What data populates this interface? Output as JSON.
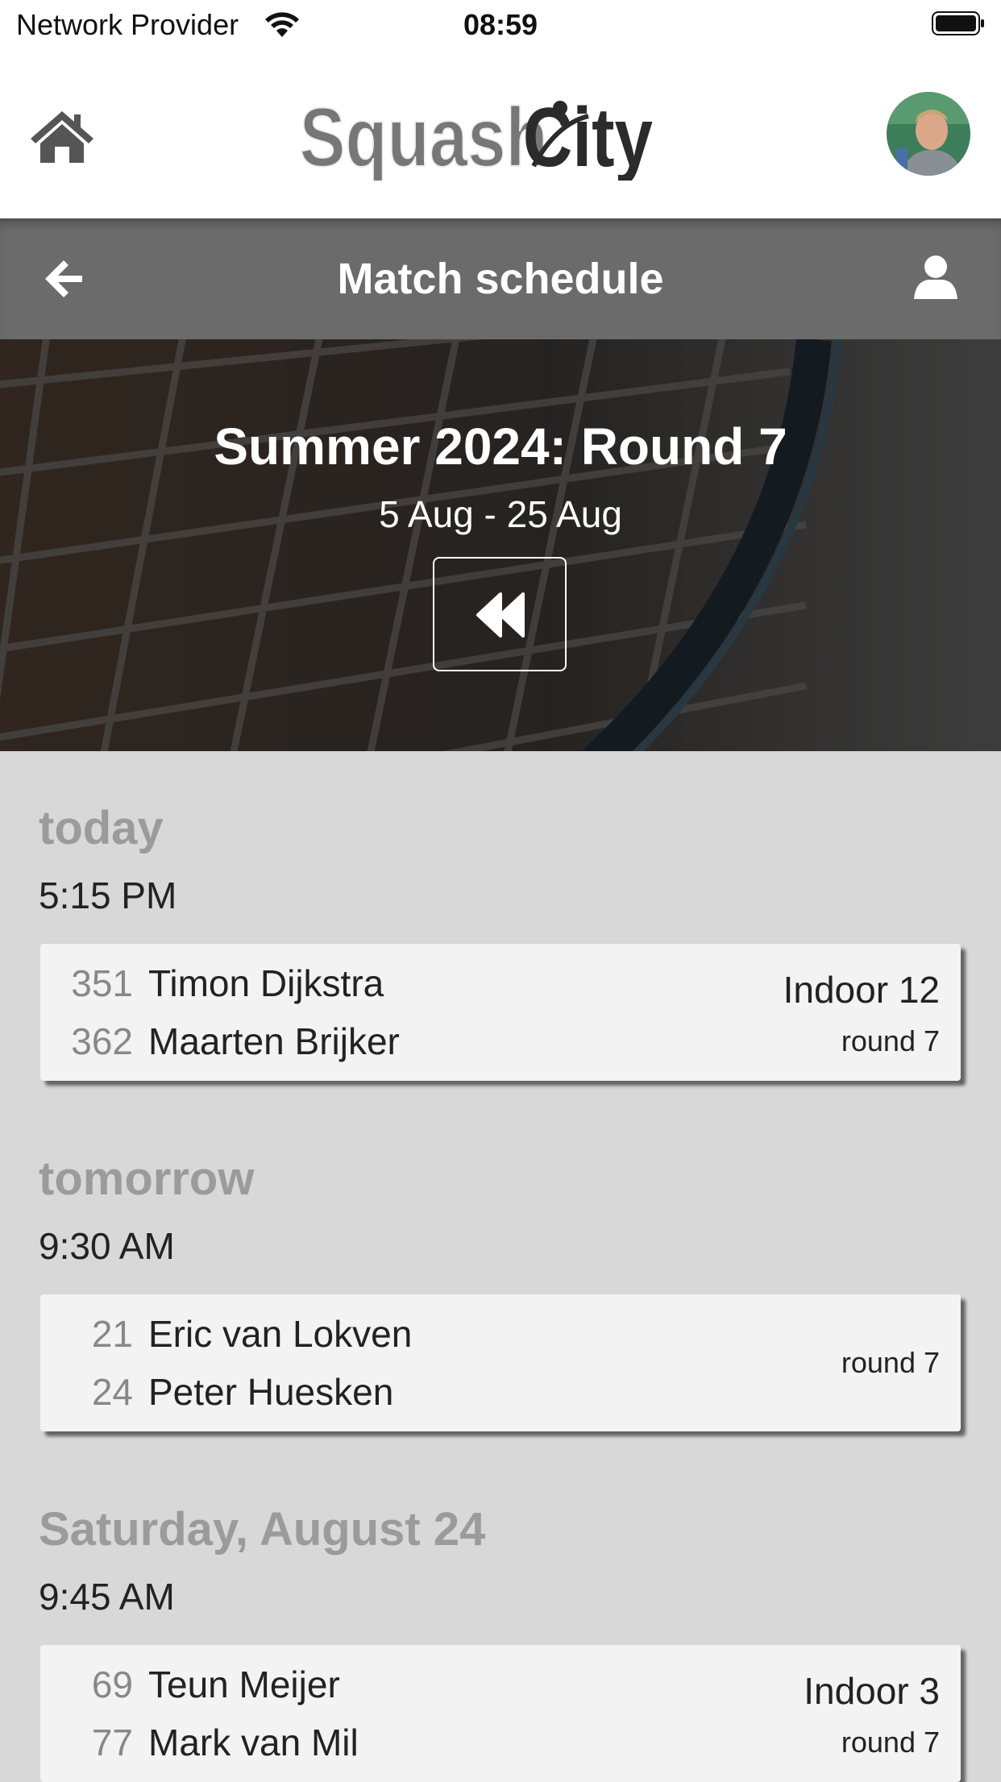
{
  "status_bar": {
    "provider": "Network Provider",
    "time": "08:59"
  },
  "header": {
    "logo_text_part1": "Squash",
    "logo_text_part2": "City"
  },
  "title_bar": {
    "title": "Match schedule"
  },
  "hero": {
    "title": "Summer 2024: Round 7",
    "dates": "5 Aug - 25 Aug"
  },
  "schedule": [
    {
      "day": "today",
      "time": "5:15 PM",
      "match": {
        "p1_num": "351",
        "p1_name": "Timon Dijkstra",
        "p2_num": "362",
        "p2_name": "Maarten Brijker",
        "court": "Indoor 12",
        "round": "round 7"
      }
    },
    {
      "day": "tomorrow",
      "time": "9:30 AM",
      "match": {
        "p1_num": "21",
        "p1_name": "Eric van Lokven",
        "p2_num": "24",
        "p2_name": "Peter Huesken",
        "court": "",
        "round": "round 7"
      }
    },
    {
      "day": "Saturday, August 24",
      "time": "9:45 AM",
      "match": {
        "p1_num": "69",
        "p1_name": "Teun Meijer",
        "p2_num": "77",
        "p2_name": "Mark van Mil",
        "court": "Indoor 3",
        "round": "round 7"
      }
    }
  ],
  "colors": {
    "title_bar": "#6b6b6b",
    "background": "#d8d8d8",
    "day_label": "#9b9b9b"
  }
}
